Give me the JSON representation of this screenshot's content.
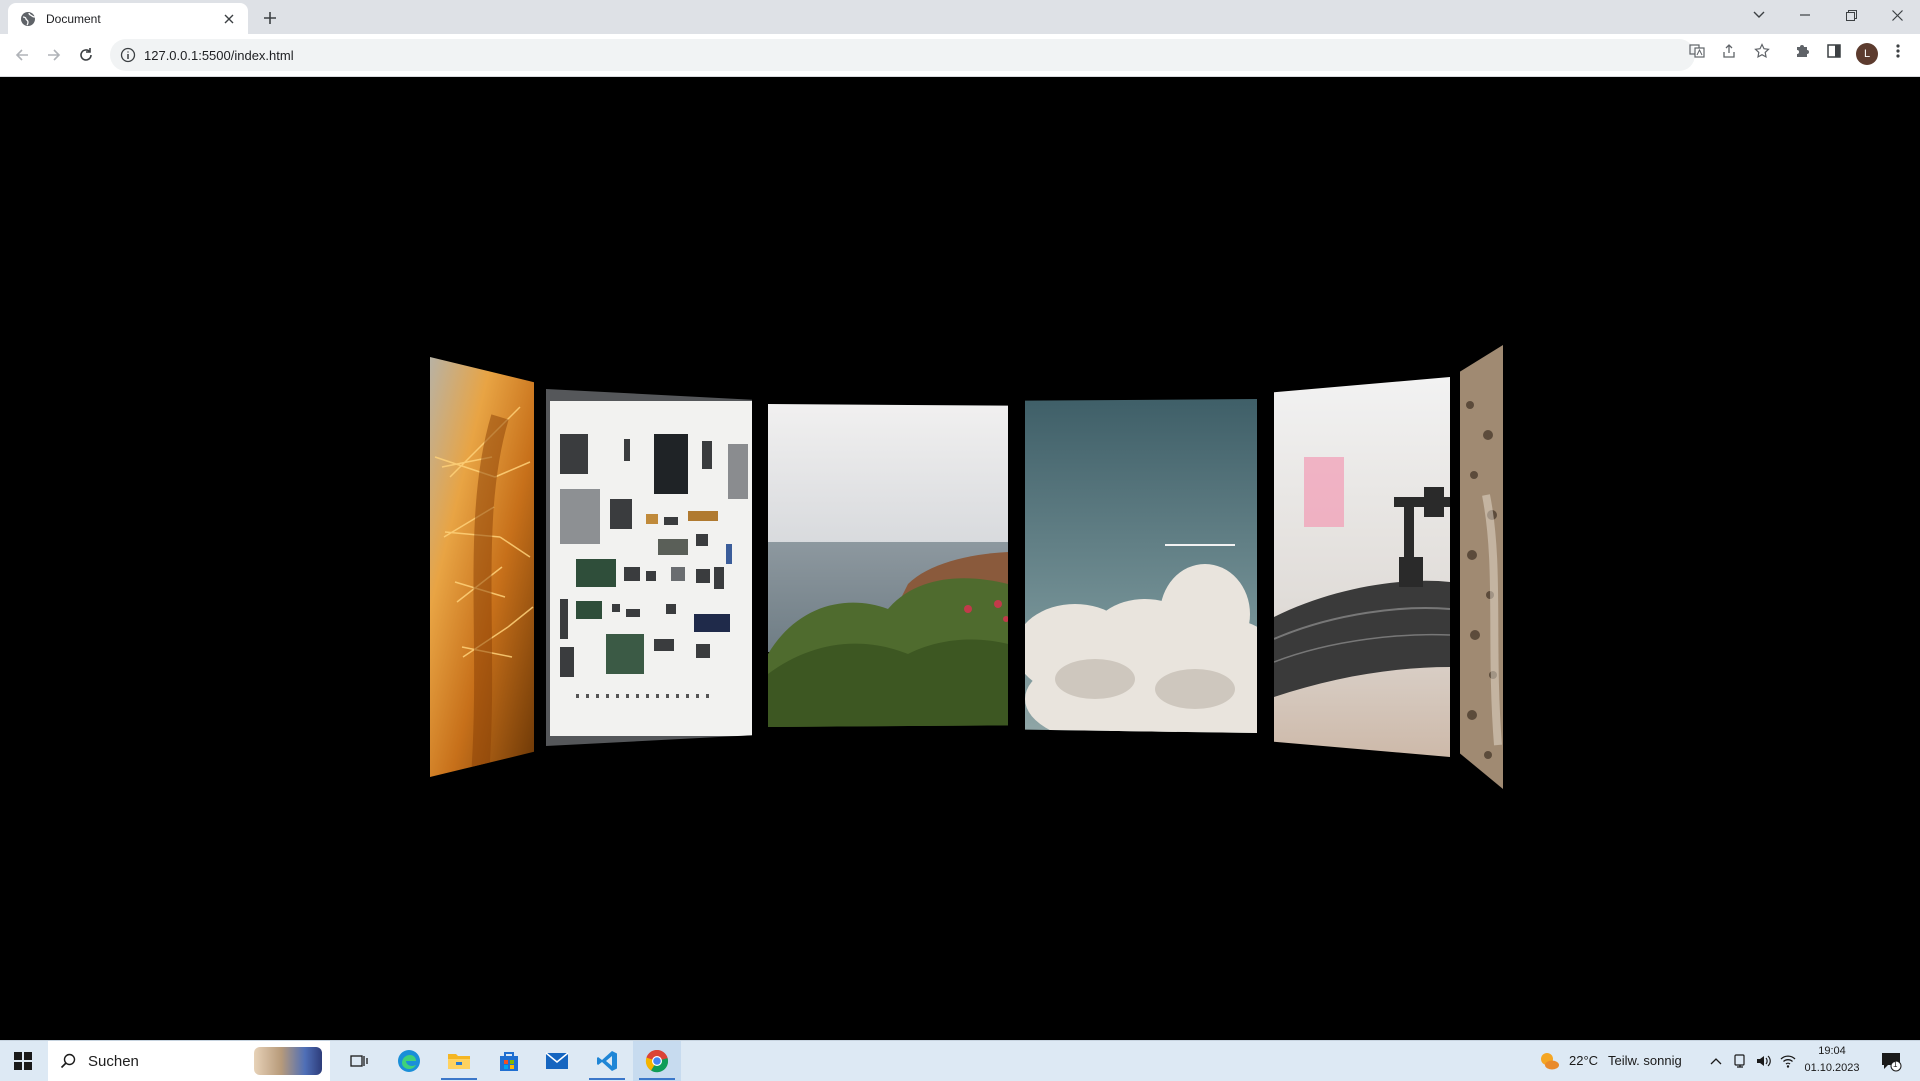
{
  "browser": {
    "tab": {
      "title": "Document"
    },
    "address": {
      "url": "127.0.0.1:5500/index.html"
    },
    "profile_initial": "L"
  },
  "gallery": {
    "panels": [
      {
        "name": "cactus-image",
        "colors": [
          "#f6c37a",
          "#d8871e",
          "#8a4208"
        ]
      },
      {
        "name": "electronics-image",
        "colors": [
          "#f4f4f2",
          "#e3e3df",
          "#444"
        ]
      },
      {
        "name": "coast-image",
        "colors": [
          "#ededee",
          "#8c9aa3",
          "#4c6a30"
        ]
      },
      {
        "name": "clouds-image",
        "colors": [
          "#4a6a72",
          "#7f9aa0",
          "#e6e1da"
        ]
      },
      {
        "name": "turntable-image",
        "colors": [
          "#eeeeee",
          "#d0c5bd",
          "#3b3b3b"
        ]
      },
      {
        "name": "leopard-image",
        "colors": [
          "#a58d73",
          "#5a4736",
          "#c9b69c"
        ]
      }
    ]
  },
  "taskbar": {
    "search_placeholder": "Suchen",
    "weather_temp": "22°C",
    "weather_desc": "Teilw. sonnig",
    "time": "19:04",
    "date": "01.10.2023",
    "notification_count": "1"
  }
}
